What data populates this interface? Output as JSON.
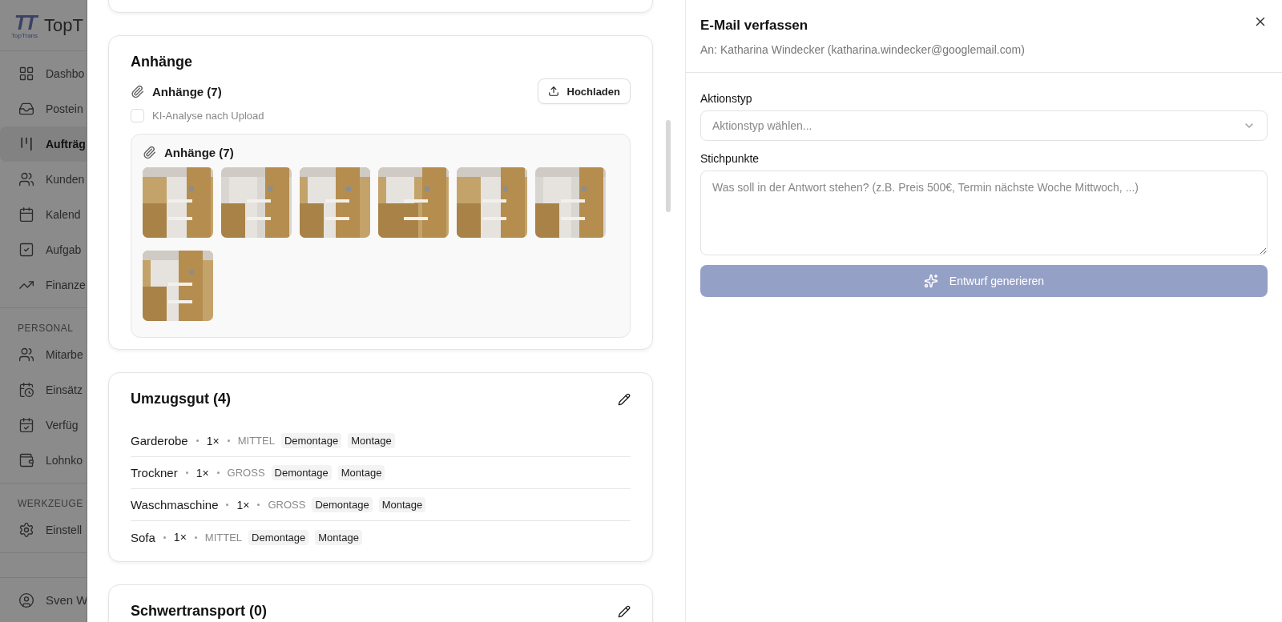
{
  "sidebar": {
    "logo_mark": "TT",
    "logo_subtitle": "TopTrans",
    "brand": "TopT",
    "groups": [
      {
        "items": [
          {
            "label": "Dashbo",
            "selected": false
          },
          {
            "label": "Postein",
            "selected": false
          },
          {
            "label": "Aufträg",
            "selected": true
          },
          {
            "label": "Kunden",
            "selected": false
          },
          {
            "label": "Kalend",
            "selected": false
          },
          {
            "label": "Aufgab",
            "selected": false
          },
          {
            "label": "Finanze",
            "selected": false
          }
        ]
      },
      {
        "heading": "PERSONAL",
        "items": [
          {
            "label": "Mitarbe",
            "selected": false
          },
          {
            "label": "Einsätz",
            "selected": false
          },
          {
            "label": "Verfüg",
            "selected": false
          },
          {
            "label": "Lohnko",
            "selected": false
          }
        ]
      },
      {
        "heading": "WERKZEUGE",
        "items": [
          {
            "label": "Einstell",
            "selected": false
          }
        ]
      }
    ],
    "user": "Sven W"
  },
  "attachments_card": {
    "title": "Anhänge",
    "header_label": "Anhänge (7)",
    "upload_button": "Hochladen",
    "ai_checkbox": {
      "label": "KI-Analyse nach Upload",
      "checked": false
    },
    "gallery": {
      "label": "Anhänge (7)"
    }
  },
  "moving_goods": {
    "title": "Umzugsgut (4)",
    "items": [
      {
        "name": "Garderobe",
        "quantity": "1×",
        "size": "MITTEL",
        "tags": [
          "Demontage",
          "Montage"
        ]
      },
      {
        "name": "Trockner",
        "quantity": "1×",
        "size": "GROSS",
        "tags": [
          "Demontage",
          "Montage"
        ]
      },
      {
        "name": "Waschmaschine",
        "quantity": "1×",
        "size": "GROSS",
        "tags": [
          "Demontage",
          "Montage"
        ]
      },
      {
        "name": "Sofa",
        "quantity": "1×",
        "size": "MITTEL",
        "tags": [
          "Demontage",
          "Montage"
        ]
      }
    ]
  },
  "heavy_transport": {
    "title": "Schwertransport (0)"
  },
  "email_panel": {
    "title": "E-Mail verfassen",
    "recipient": "An: Katharina Windecker (katharina.windecker@googlemail.com)",
    "action_type": {
      "label": "Aktionstyp",
      "placeholder": "Aktionstyp wählen..."
    },
    "notes": {
      "label": "Stichpunkte",
      "placeholder": "Was soll in der Antwort stehen? (z.B. Preis 500€, Termin nächste Woche Mittwoch, ...)"
    },
    "generate_button": {
      "label": "Entwurf generieren",
      "disabled": true
    }
  }
}
